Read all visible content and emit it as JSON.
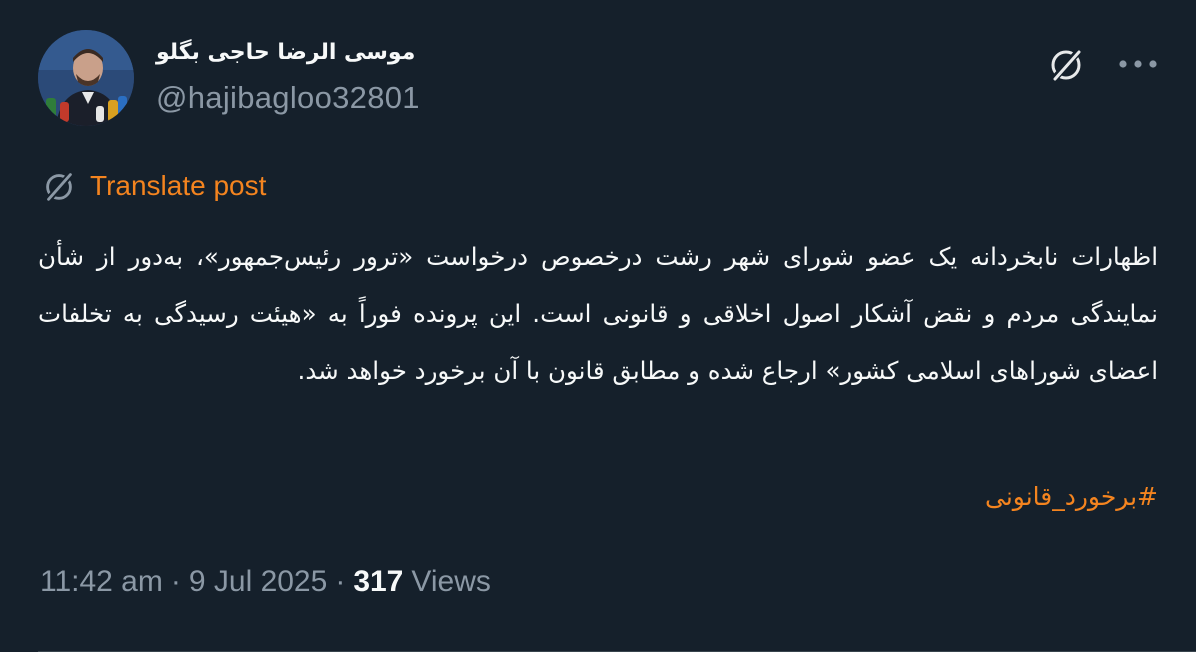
{
  "author": {
    "display_name": "موسی الرضا حاجی بگلو",
    "handle": "@hajibagloo32801"
  },
  "icons": {
    "grok": "grok-icon",
    "more": "more-horizontal-icon",
    "translate": "grok-translate-icon"
  },
  "translate": {
    "label": "Translate post"
  },
  "post": {
    "text": "اظهارات نابخردانه یک عضو شورای شهر رشت درخصوص درخواست «ترور رئیس‌جمهور»، به‌دور از شأن نمایندگی مردم و نقض آشکار اصول اخلاقی و قانونی است. این پرونده فوراً به «هیئت رسیدگی به تخلفات اعضای شوراهای اسلامی کشور» ارجاع شده و مطابق قانون با آن برخورد خواهد شد.",
    "hashtag": "#برخورد_قانونی"
  },
  "meta": {
    "time": "11:42 am",
    "date": "9 Jul 2025",
    "separator": "·",
    "views_count": "317",
    "views_label": "Views"
  },
  "colors": {
    "background": "#15202b",
    "accent": "#f4841f",
    "secondary_text": "#8b98a5",
    "primary_text": "#f7f9f9"
  }
}
